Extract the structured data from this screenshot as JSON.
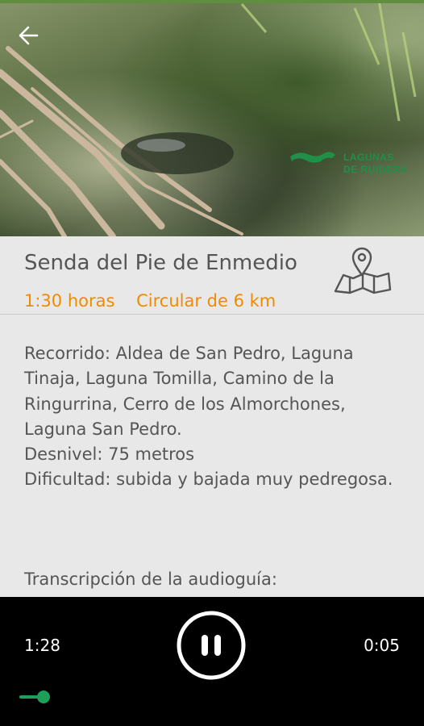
{
  "photo": {
    "alt_icon": "forest-photo"
  },
  "logo": {
    "text": "LAGUNAS\nDE RUIDERA"
  },
  "route": {
    "title": "Senda del Pie de Enmedio",
    "duration": "1:30 horas",
    "type": "Circular de 6 km"
  },
  "description": {
    "recorrido": "Recorrido: Aldea de San Pedro, Laguna Tinaja, Laguna Tomilla, Camino de la Ringurrina, Cerro de los Almorchones, Laguna San Pedro.",
    "desnivel": "Desnivel: 75 metros",
    "dificultad": "Dificultad: subida y bajada muy pedregosa.",
    "transcripcion": "Transcripción de la audioguía:"
  },
  "player": {
    "current_time": "1:28",
    "remaining_time": "0:05",
    "progress_fraction": 0.05,
    "accent": "#1f9e5a"
  },
  "colors": {
    "accent_orange": "#f08b00",
    "text_gray": "#555555"
  }
}
